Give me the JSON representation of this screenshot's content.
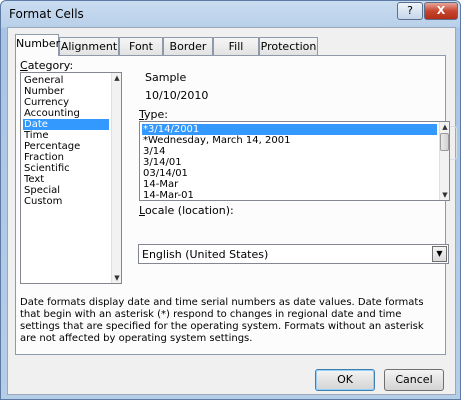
{
  "window": {
    "title": "Format Cells",
    "help_glyph": "?",
    "close_glyph": "X"
  },
  "tabs": [
    {
      "label": "Number"
    },
    {
      "label": "Alignment"
    },
    {
      "label": "Font"
    },
    {
      "label": "Border"
    },
    {
      "label": "Fill"
    },
    {
      "label": "Protection"
    }
  ],
  "category": {
    "label_first": "C",
    "label_rest": "ategory:",
    "items": [
      "General",
      "Number",
      "Currency",
      "Accounting",
      "Date",
      "Time",
      "Percentage",
      "Fraction",
      "Scientific",
      "Text",
      "Special",
      "Custom"
    ],
    "selected": "Date"
  },
  "sample": {
    "label": "Sample",
    "value": "10/10/2010"
  },
  "type": {
    "label_first": "T",
    "label_rest": "ype:",
    "items": [
      "*3/14/2001",
      "*Wednesday, March 14, 2001",
      "3/14",
      "3/14/01",
      "03/14/01",
      "14-Mar",
      "14-Mar-01"
    ],
    "selected": "*3/14/2001"
  },
  "locale": {
    "label_first": "L",
    "label_rest": "ocale (location):",
    "value": "English (United States)"
  },
  "description": "Date formats display date and time serial numbers as date values.  Date formats that begin with an asterisk (*) respond to changes in regional date and time settings that are specified for the operating system. Formats without an asterisk are not affected by operating system settings.",
  "buttons": {
    "ok": "OK",
    "cancel": "Cancel"
  },
  "icons": {
    "scroll_up": "▲",
    "scroll_down": "▼",
    "dropdown": "▼"
  }
}
